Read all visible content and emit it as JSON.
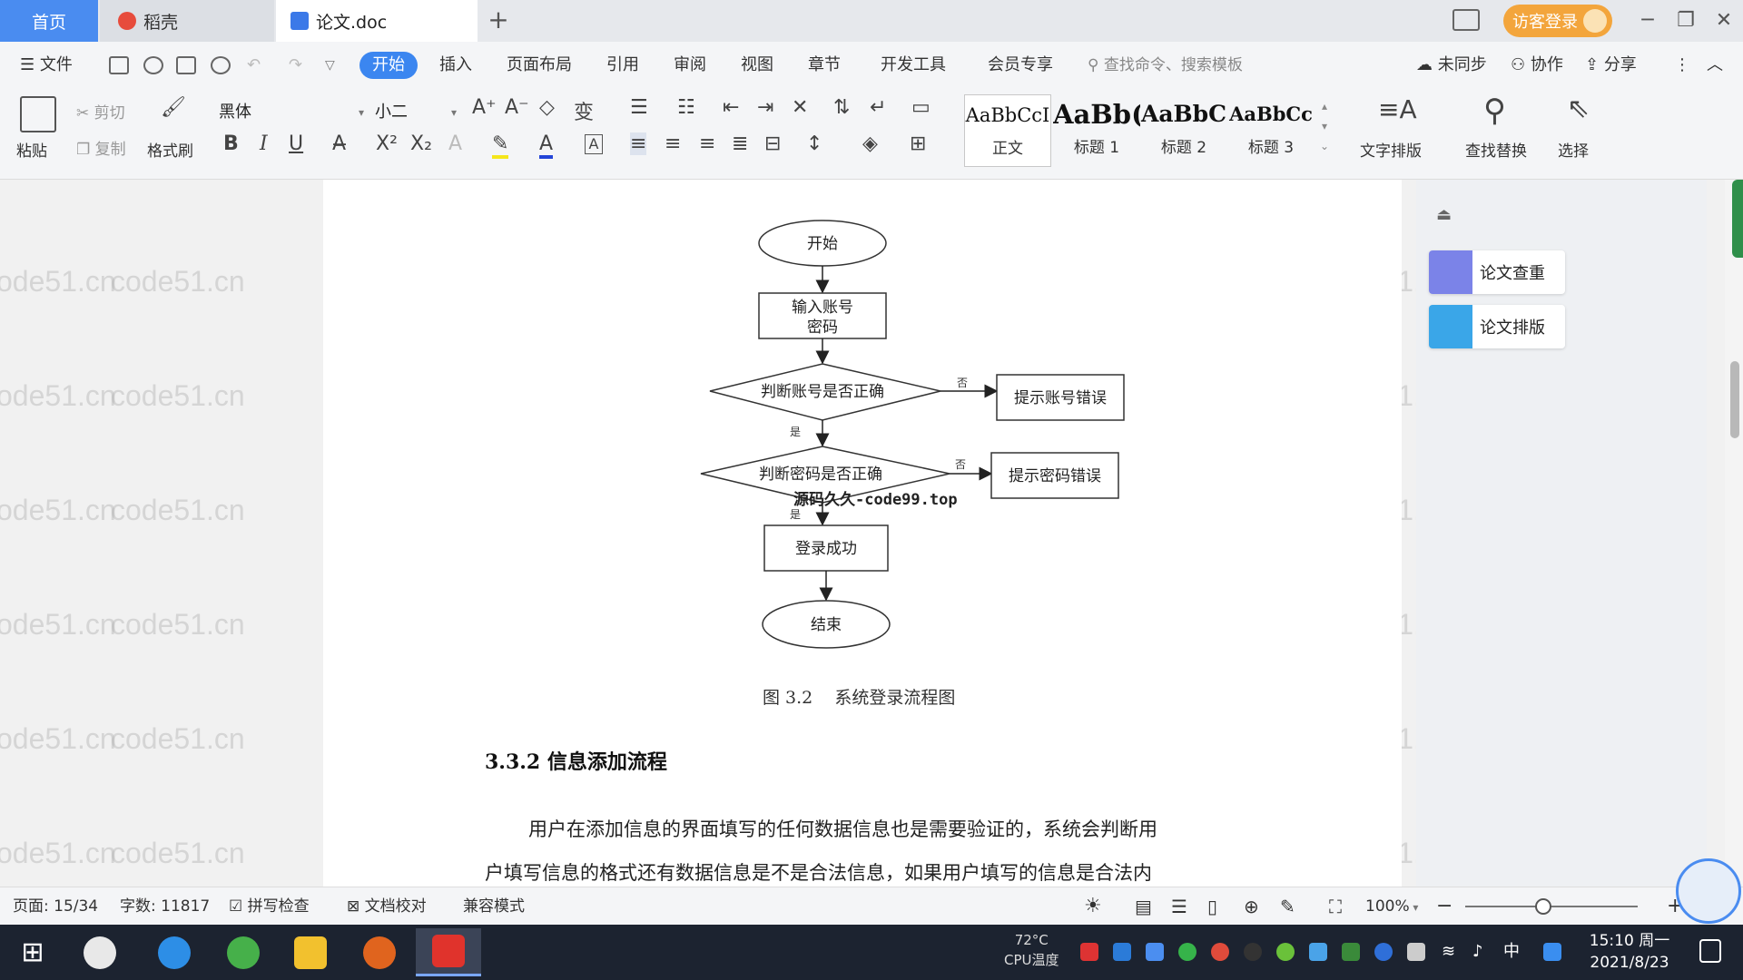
{
  "tabs": {
    "home": "首页",
    "daoke": "稻壳",
    "doc": "论文.doc",
    "add": "+"
  },
  "titlebar": {
    "visitor_login": "访客登录",
    "minimize": "─",
    "restore": "❐",
    "close": "✕"
  },
  "menu": {
    "file": "文件",
    "items": [
      "开始",
      "插入",
      "页面布局",
      "引用",
      "审阅",
      "视图",
      "章节",
      "开发工具",
      "会员专享"
    ],
    "search_placeholder": "查找命令、搜索模板",
    "unsynced": "未同步",
    "collaborate": "协作",
    "share": "分享"
  },
  "ribbon": {
    "paste": "粘贴",
    "cut": "剪切",
    "copy": "复制",
    "format_painter": "格式刷",
    "font_name": "黑体",
    "font_size": "小二",
    "styles": [
      {
        "sample": "AaBbCcI",
        "name": "正文"
      },
      {
        "sample": "AaBb(",
        "name": "标题 1"
      },
      {
        "sample": "AaBbC",
        "name": "标题 2"
      },
      {
        "sample": "AaBbCc",
        "name": "标题 3"
      }
    ],
    "text_layout": "文字排版",
    "find_replace": "查找替换",
    "select": "选择"
  },
  "side_panel": {
    "check": "论文查重",
    "layout": "论文排版"
  },
  "watermark_text": "code51.cn",
  "flowchart": {
    "start": "开始",
    "input_line1": "输入账号",
    "input_line2": "密码",
    "check_account": "判断账号是否正确",
    "check_password": "判断密码是否正确",
    "err_account": "提示账号错误",
    "err_password": "提示密码错误",
    "success": "登录成功",
    "end": "结束",
    "no": "否",
    "yes": "是"
  },
  "source_mark": "源码久久-code99.top",
  "caption": "图 3.2    系统登录流程图",
  "heading": "3.3.2 信息添加流程",
  "paragraph_lines": [
    "用户在添加信息的界面填写的任何数据信息也是需要验证的，系统会判断用",
    "户填写信息的格式还有数据信息是不是合法信息，如果用户填写的信息是合法内"
  ],
  "statusbar": {
    "page": "页面: 15/34",
    "words": "字数: 11817",
    "spell": "拼写检查",
    "proof": "文档校对",
    "compat": "兼容模式",
    "zoom": "100%",
    "zoom_level": 0.45
  },
  "taskbar": {
    "cpu_temp": "72°C",
    "cpu_label": "CPU温度",
    "ime": "中",
    "time": "15:10 周一",
    "date": "2021/8/23"
  }
}
